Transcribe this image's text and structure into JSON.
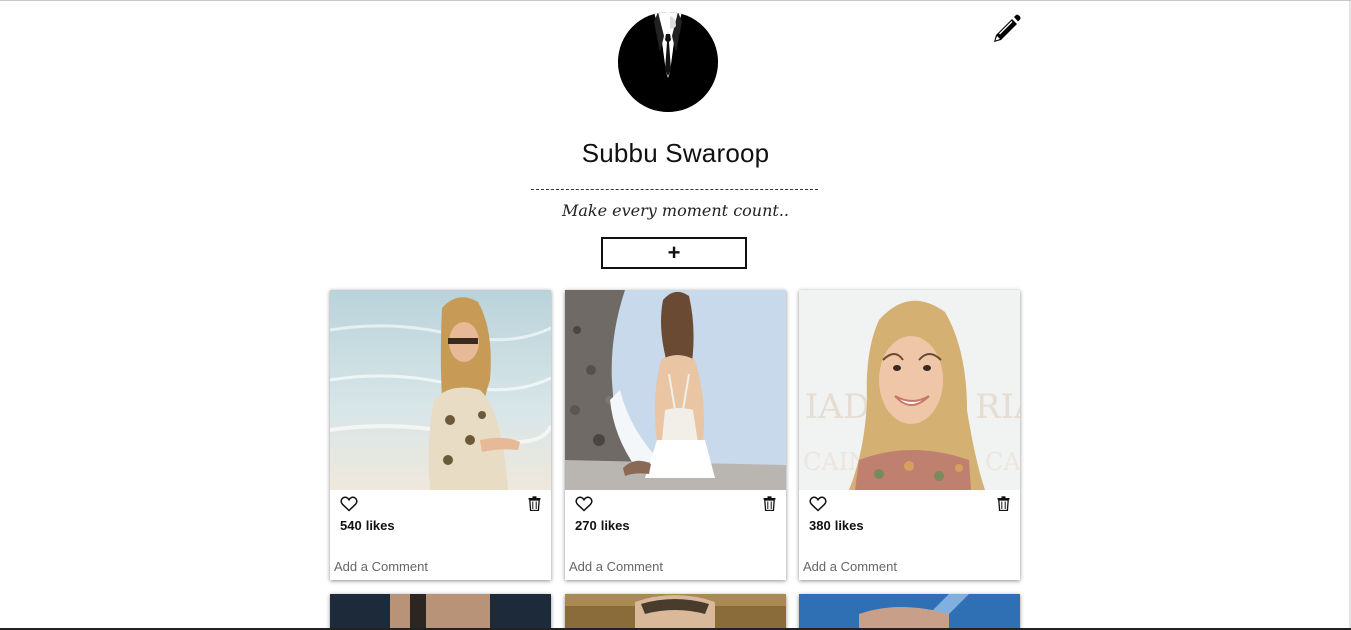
{
  "profile": {
    "name": "Subbu Swaroop",
    "bio": "Make every moment count.."
  },
  "actions": {
    "add_label": "+"
  },
  "posts": [
    {
      "likes": "540",
      "likes_word": "likes",
      "comment_placeholder": "Add a Comment"
    },
    {
      "likes": "270",
      "likes_word": "likes",
      "comment_placeholder": "Add a Comment"
    },
    {
      "likes": "380",
      "likes_word": "likes",
      "comment_placeholder": "Add a Comment"
    }
  ],
  "icons": {
    "edit": "pencil-icon",
    "like": "heart-icon",
    "delete": "trash-icon"
  },
  "colors": {
    "text": "#111111",
    "card_shadow": "#737373",
    "placeholder": "#666666"
  }
}
